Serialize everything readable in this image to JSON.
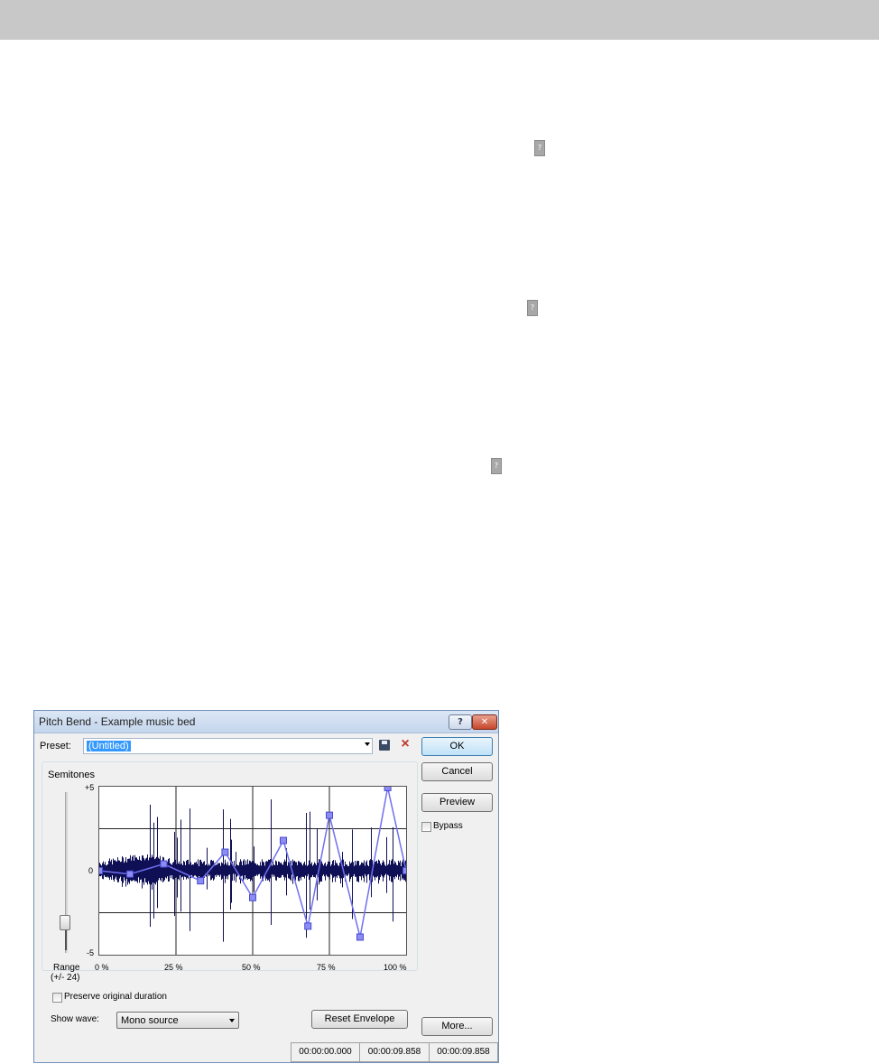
{
  "page": {
    "help_markers": [
      "?",
      "?",
      "?"
    ]
  },
  "dialog": {
    "title": "Pitch Bend - Example music bed",
    "title_buttons": {
      "help": "?",
      "close": "✕"
    },
    "preset_label": "Preset:",
    "preset_value": "(Untitled)",
    "buttons": {
      "ok": "OK",
      "cancel": "Cancel",
      "preview": "Preview",
      "more": "More...",
      "reset": "Reset Envelope"
    },
    "bypass_label": "Bypass",
    "bypass_checked": false,
    "group_label": "Semitones",
    "range_label": "Range",
    "range_value": "(+/- 24)",
    "y_ticks": [
      "+5",
      "0",
      "-5"
    ],
    "x_ticks": [
      "0 %",
      "25 %",
      "50 %",
      "75 %",
      "100 %"
    ],
    "preserve_label": "Preserve original duration",
    "preserve_checked": false,
    "show_wave_label": "Show wave:",
    "show_wave_value": "Mono source",
    "status": [
      "00:00:00.000",
      "00:00:09.858",
      "00:00:09.858"
    ],
    "colors": {
      "waveform": "#0f0f55",
      "envelope": "#7070f0",
      "selection": "#3399ff"
    }
  },
  "chart_data": {
    "type": "line",
    "xlim": [
      0,
      100
    ],
    "ylim": [
      -5,
      5
    ],
    "envelope": [
      {
        "x": 0,
        "y": 0
      },
      {
        "x": 10,
        "y": -0.4
      },
      {
        "x": 21,
        "y": 0.8
      },
      {
        "x": 33,
        "y": -1.2
      },
      {
        "x": 41,
        "y": 2.2
      },
      {
        "x": 50,
        "y": -3.2
      },
      {
        "x": 60,
        "y": 3.6
      },
      {
        "x": 68,
        "y": -6.6
      },
      {
        "x": 75,
        "y": 6.6
      },
      {
        "x": 85,
        "y": -7.9
      },
      {
        "x": 94,
        "y": 9.9
      },
      {
        "x": 100,
        "y": 0
      }
    ],
    "y_display_range": [
      -10,
      10
    ]
  }
}
